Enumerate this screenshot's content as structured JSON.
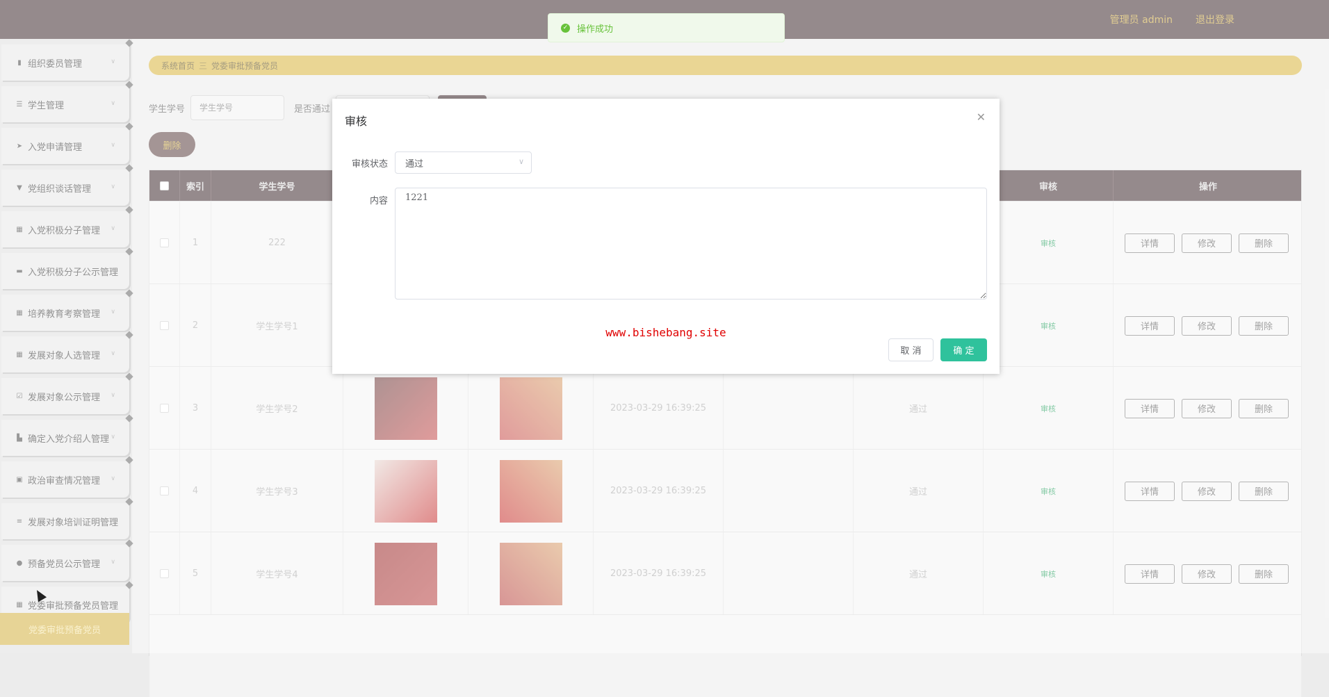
{
  "header": {
    "user": "管理员 admin",
    "logout": "退出登录"
  },
  "sidebar": {
    "items": [
      {
        "label": "组织委员管理",
        "icon": "bar-chart-icon"
      },
      {
        "label": "学生管理",
        "icon": "sliders-icon"
      },
      {
        "label": "入党申请管理",
        "icon": "send-icon"
      },
      {
        "label": "党组织谈话管理",
        "icon": "podium-icon"
      },
      {
        "label": "入党积极分子管理",
        "icon": "grid-icon"
      },
      {
        "label": "入党积极分子公示管理",
        "icon": "comment-icon"
      },
      {
        "label": "培养教育考察管理",
        "icon": "grid-icon"
      },
      {
        "label": "发展对象人选管理",
        "icon": "grid-icon"
      },
      {
        "label": "发展对象公示管理",
        "icon": "checkbox-icon"
      },
      {
        "label": "确定入党介绍人管理",
        "icon": "thumb-icon"
      },
      {
        "label": "政治审查情况管理",
        "icon": "clipboard-icon"
      },
      {
        "label": "发展对象培训证明管理",
        "icon": "list-icon"
      },
      {
        "label": "预备党员公示管理",
        "icon": "pin-icon"
      },
      {
        "label": "党委审批预备党员管理",
        "icon": "grid-icon"
      }
    ],
    "active_sub": "党委审批预备党员"
  },
  "breadcrumb": {
    "home": "系统首页",
    "sep": "三",
    "current": "党委审批预备党员"
  },
  "search": {
    "student_no_label": "学生学号",
    "student_no_placeholder": "学生学号",
    "pass_label": "是否通过"
  },
  "delete_button": "删除",
  "table": {
    "headers": {
      "index": "索引",
      "student_no": "学生学号",
      "audit": "审核",
      "ops": "操作"
    },
    "rows": [
      {
        "index": "1",
        "student_no": "222",
        "time": "",
        "passed": "",
        "audit": "审核"
      },
      {
        "index": "2",
        "student_no": "学生学号1",
        "time": "",
        "passed": "",
        "audit": "审核"
      },
      {
        "index": "3",
        "student_no": "学生学号2",
        "time": "2023-03-29 16:39:25",
        "passed": "通过",
        "audit": "审核"
      },
      {
        "index": "4",
        "student_no": "学生学号3",
        "time": "2023-03-29 16:39:25",
        "passed": "通过",
        "audit": "审核"
      },
      {
        "index": "5",
        "student_no": "学生学号4",
        "time": "2023-03-29 16:39:25",
        "passed": "通过",
        "audit": "审核"
      }
    ],
    "actions": {
      "detail": "详情",
      "edit": "修改",
      "delete": "删除"
    }
  },
  "dialog": {
    "title": "审核",
    "status_label": "审核状态",
    "status_value": "通过",
    "content_label": "内容",
    "content_value": "1221",
    "watermark": "www.bishebang.site",
    "cancel": "取 消",
    "confirm": "确 定"
  },
  "toast": {
    "message": "操作成功"
  },
  "colors": {
    "topbar": "#3f2b2f",
    "accent": "#d9b53d",
    "confirm": "#2fc29c",
    "success": "#67c23a"
  }
}
